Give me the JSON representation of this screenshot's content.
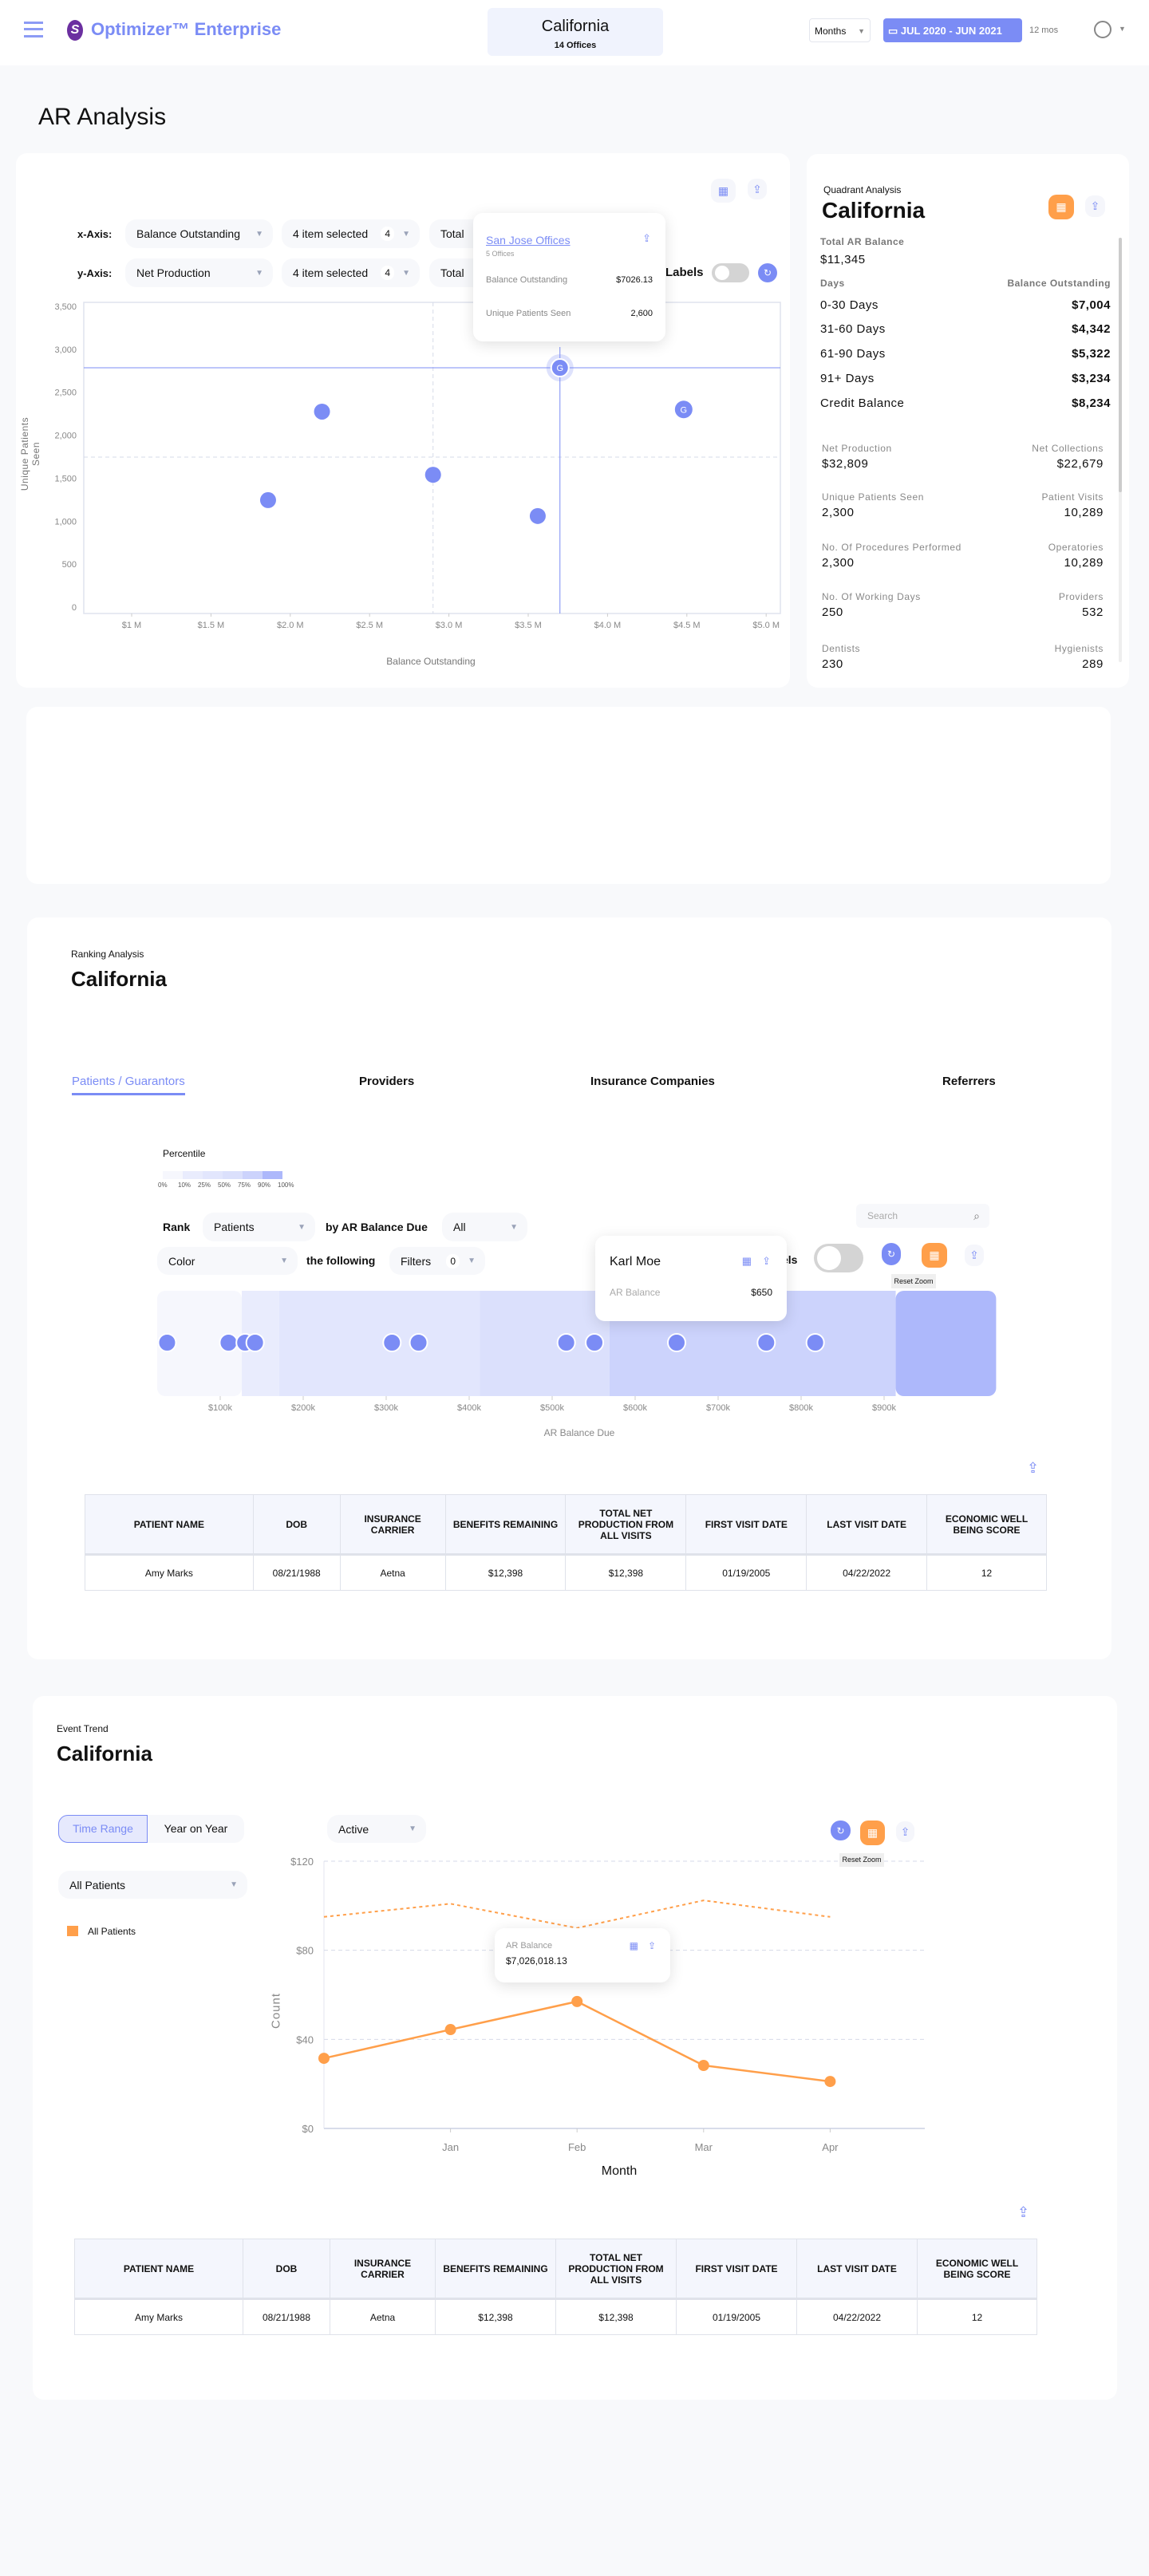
{
  "colors": {
    "primary": "#7b8cf5",
    "orange": "#ff9f4a",
    "page_bg": "#f8f9fb",
    "header_box": "#f0f3fd"
  },
  "header": {
    "app_name": "Optimizer™ Enterprise",
    "location": "California",
    "offices": "14 Offices",
    "period_select": "Months",
    "date_range": "JUL 2020 - JUN 2021",
    "duration": "12 mos",
    "icons": [
      "menu-icon",
      "logo-icon",
      "calendar-icon",
      "user-icon",
      "chevron-down-icon"
    ]
  },
  "page_title": "AR Analysis",
  "scatter": {
    "x_axis_label": "x-Axis:",
    "y_axis_label": "y-Axis:",
    "x_metric": "Balance Outstanding",
    "y_metric": "Net Production",
    "x_items": "4 item selected",
    "x_items_count": "4",
    "y_items": "4 item selected",
    "y_items_count": "4",
    "x_total": "Total",
    "y_total": "Total",
    "labels_text": "Labels",
    "labels_on": false,
    "tooltip": {
      "title": "San Jose Offices",
      "subtitle": "5 Offices",
      "rows": [
        {
          "label": "Balance Outstanding",
          "value": "$7026.13"
        },
        {
          "label": "Unique Patients Seen",
          "value": "2,600"
        }
      ]
    }
  },
  "quadrant": {
    "label": "Quadrant Analysis",
    "title": "California",
    "total_label": "Total AR Balance",
    "total_value": "$11,345",
    "days_header": "Days",
    "balance_header": "Balance Outstanding",
    "days": [
      {
        "label": "0-30 Days",
        "value": "$7,004"
      },
      {
        "label": "31-60 Days",
        "value": "$4,342"
      },
      {
        "label": "61-90 Days",
        "value": "$5,322"
      },
      {
        "label": "91+ Days",
        "value": "$3,234"
      },
      {
        "label": "Credit Balance",
        "value": "$8,234"
      }
    ],
    "stats": [
      {
        "left_label": "Net Production",
        "left_value": "$32,809",
        "right_label": "Net Collections",
        "right_value": "$22,679"
      },
      {
        "left_label": "Unique Patients Seen",
        "left_value": "2,300",
        "right_label": "Patient Visits",
        "right_value": "10,289"
      },
      {
        "left_label": "No. Of Procedures Performed",
        "left_value": "2,300",
        "right_label": "Operatories",
        "right_value": "10,289"
      },
      {
        "left_label": "No. Of Working Days",
        "left_value": "250",
        "right_label": "Providers",
        "right_value": "532"
      },
      {
        "left_label": "Dentists",
        "left_value": "230",
        "right_label": "Hygienists",
        "right_value": "289"
      }
    ]
  },
  "ranking": {
    "label": "Ranking Analysis",
    "title": "California",
    "tabs": [
      {
        "label": "Patients / Guarantors",
        "active": true
      },
      {
        "label": "Providers"
      },
      {
        "label": "Insurance Companies"
      },
      {
        "label": "Referrers"
      }
    ],
    "percentile_label": "Percentile",
    "percentile_ticks": [
      "0%",
      "10%",
      "25%",
      "50%",
      "75%",
      "90%",
      "100%"
    ],
    "percentile_colors": [
      "#f6f7fd",
      "#e9ecfd",
      "#e2e6fd",
      "#dbe0fc",
      "#ccd3fc",
      "#adb8fb"
    ],
    "rank_label": "Rank",
    "rank_select": "Patients",
    "by_label": "by AR Balance Due",
    "scope_select": "All",
    "color_select": "Color",
    "following_label": "the following",
    "filters_select": "Filters",
    "filters_count": "0",
    "search_placeholder": "Search",
    "labels_partial": "els",
    "reset_zoom": "Reset Zoom",
    "tooltip": {
      "name": "Karl Moe",
      "label": "AR Balance",
      "value": "$650"
    },
    "table": {
      "columns": [
        "Patient Name",
        "DOB",
        "Insurance Carrier",
        "Benefits Remaining",
        "Total Net Production From All Visits",
        "First Visit Date",
        "Last Visit Date",
        "Economic Well Being Score"
      ],
      "rows": [
        [
          "Amy Marks",
          "08/21/1988",
          "Aetna",
          "$12,398",
          "$12,398",
          "01/19/2005",
          "04/22/2022",
          "12"
        ]
      ]
    }
  },
  "trend": {
    "label": "Event Trend",
    "title": "California",
    "toggle": [
      "Time Range",
      "Year on Year"
    ],
    "active_toggle": "Time Range",
    "status_select": "Active",
    "group_select": "All Patients",
    "legend": "All Patients",
    "reset_zoom": "Reset Zoom",
    "tooltip": {
      "label": "AR Balance",
      "value": "$7,026,018.13"
    },
    "table": {
      "columns": [
        "Patient Name",
        "DOB",
        "Insurance Carrier",
        "Benefits Remaining",
        "Total Net Production From All Visits",
        "First Visit Date",
        "Last Visit Date",
        "Economic Well Being Score"
      ],
      "rows": [
        [
          "Amy Marks",
          "08/21/1988",
          "Aetna",
          "$12,398",
          "$12,398",
          "01/19/2005",
          "04/22/2022",
          "12"
        ]
      ]
    }
  },
  "chart_data": [
    {
      "type": "scatter",
      "xlabel": "Balance Outstanding",
      "ylabel": "Unique Patients Seen",
      "xlim": [
        0.55,
        5.05
      ],
      "ylim": [
        0,
        3500
      ],
      "x_ticks": [
        "$1 M",
        "$1.5 M",
        "$2.0 M",
        "$2.5 M",
        "$3.0 M",
        "$3.5 M",
        "$4.0 M",
        "$4.5 M",
        "$5.0 M"
      ],
      "x_tick_values": [
        1,
        1.5,
        2,
        2.5,
        3,
        3.5,
        4,
        4.5,
        5
      ],
      "y_ticks": [
        "3,500",
        "3,000",
        "2,500",
        "2,000",
        "1,500",
        "1,000",
        "500",
        "0"
      ],
      "y_tick_values": [
        3500,
        3000,
        2500,
        2000,
        1500,
        1000,
        500,
        0
      ],
      "points": [
        {
          "x": 2.2,
          "y": 2275
        },
        {
          "x": 1.86,
          "y": 1245
        },
        {
          "x": 2.9,
          "y": 1540
        },
        {
          "x": 3.56,
          "y": 1060
        },
        {
          "x": 3.7,
          "y": 2785,
          "label": "G",
          "highlighted": true
        },
        {
          "x": 4.48,
          "y": 2300,
          "label": "G"
        }
      ],
      "median_lines": {
        "x": 2.9,
        "y": 1745
      },
      "crosshair": {
        "x": 3.7,
        "y": 2785
      }
    },
    {
      "type": "scatter",
      "xlabel": "AR Balance Due",
      "unit": "$k",
      "x_ticks": [
        "$100k",
        "$200k",
        "$300k",
        "$400k",
        "$500k",
        "$600k",
        "$700k",
        "$800k",
        "$900k"
      ],
      "x_tick_values": [
        100,
        200,
        300,
        400,
        500,
        600,
        700,
        800,
        900
      ],
      "percentile_bands": [
        [
          24,
          126
        ],
        [
          126,
          171
        ],
        [
          171,
          413
        ],
        [
          413,
          569
        ],
        [
          569,
          914
        ],
        [
          914,
          1035
        ]
      ],
      "values": [
        36,
        110,
        130,
        142,
        307,
        339,
        517,
        551,
        650,
        758,
        817
      ]
    },
    {
      "type": "line",
      "xlabel": "Month",
      "ylabel": "Count",
      "categories": [
        "",
        "Jan",
        "Feb",
        "Mar",
        "Apr"
      ],
      "ylim": [
        0,
        120
      ],
      "y_ticks": [
        "$120",
        "$80",
        "$40",
        "$0"
      ],
      "y_tick_values": [
        120,
        80,
        40,
        0
      ],
      "grid": true,
      "series": [
        {
          "name": "All Patients",
          "style": "solid",
          "values": [
            31.5,
            44.4,
            57,
            28.3,
            21.1
          ]
        },
        {
          "style": "dashed",
          "values": [
            95,
            100.9,
            90,
            102.4,
            95
          ]
        }
      ]
    }
  ]
}
